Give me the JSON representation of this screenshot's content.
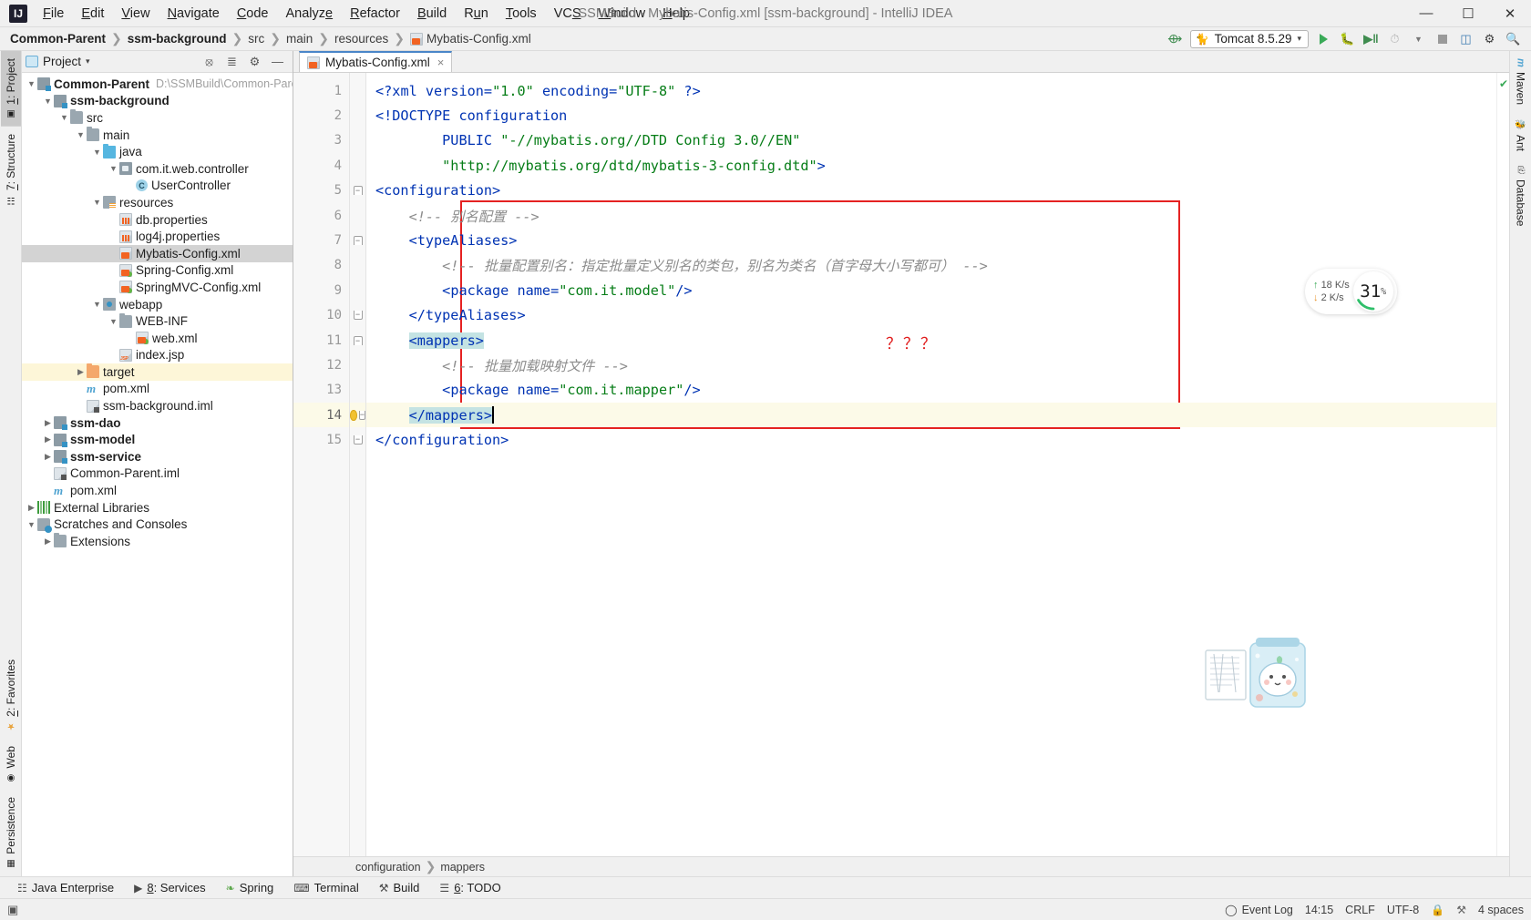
{
  "window": {
    "title": "SSMBuild - Mybatis-Config.xml [ssm-background] - IntelliJ IDEA",
    "logo": "IJ",
    "minimize": "—",
    "maximize": "☐",
    "close": "✕"
  },
  "menu": [
    {
      "label": "File"
    },
    {
      "label": "Edit"
    },
    {
      "label": "View"
    },
    {
      "label": "Navigate"
    },
    {
      "label": "Code"
    },
    {
      "label": "Analyze"
    },
    {
      "label": "Refactor"
    },
    {
      "label": "Build"
    },
    {
      "label": "Run"
    },
    {
      "label": "Tools"
    },
    {
      "label": "VCS"
    },
    {
      "label": "Window"
    },
    {
      "label": "Help"
    }
  ],
  "breadcrumb": [
    {
      "label": "Common-Parent",
      "bold": true
    },
    {
      "label": "ssm-background",
      "bold": true
    },
    {
      "label": "src",
      "bold": false
    },
    {
      "label": "main",
      "bold": false
    },
    {
      "label": "resources",
      "bold": false
    },
    {
      "label": "Mybatis-Config.xml",
      "bold": false,
      "icon": "xml-icon"
    }
  ],
  "toolbar": {
    "build_icon": "hammer-icon",
    "run_config": "Tomcat 8.5.29",
    "dropdown_arrow": "▾",
    "run_icon": "run-icon",
    "debug_icon": "debug-icon",
    "run_coverage_icon": "run-with-coverage-icon",
    "profile_icon": "profile-icon",
    "stop_icon": "stop-icon",
    "layout_icon": "restore-layout-icon",
    "search_icon": "search-everywhere-icon",
    "settings_icon": "settings-icon"
  },
  "left_rail": {
    "top": [
      {
        "label": "1: Project",
        "underline": "1",
        "selected": true,
        "icon": "project-icon"
      },
      {
        "label": "7: Structure",
        "underline": "7",
        "selected": false,
        "icon": "structure-icon"
      }
    ],
    "bottom": [
      {
        "label": "2: Favorites",
        "underline": "2",
        "icon": "star-icon"
      },
      {
        "label": "Web",
        "icon": "web-icon"
      },
      {
        "label": "Persistence",
        "icon": "persistence-icon"
      }
    ]
  },
  "right_rail": [
    {
      "label": "Maven",
      "icon": "maven-icon"
    },
    {
      "label": "Ant",
      "icon": "ant-icon"
    },
    {
      "label": "Database",
      "icon": "database-icon"
    }
  ],
  "project_panel": {
    "title": "Project",
    "dropdown_arrow": "▾",
    "locate_icon": "locate-icon",
    "collapse_icon": "collapse-all-icon",
    "settings_icon": "gear-icon",
    "hide_icon": "hide-icon",
    "tree": [
      {
        "depth": 0,
        "twisty": "▼",
        "icon": "ic-mod",
        "label": "Common-Parent",
        "bold": true,
        "path": "D:\\SSMBuild\\Common-Parent"
      },
      {
        "depth": 1,
        "twisty": "▼",
        "icon": "ic-mod",
        "label": "ssm-background",
        "bold": true
      },
      {
        "depth": 2,
        "twisty": "▼",
        "icon": "ic-folder",
        "label": "src"
      },
      {
        "depth": 3,
        "twisty": "▼",
        "icon": "ic-folder",
        "label": "main"
      },
      {
        "depth": 4,
        "twisty": "▼",
        "icon": "ic-src",
        "label": "java"
      },
      {
        "depth": 5,
        "twisty": "▼",
        "icon": "ic-pkg",
        "label": "com.it.web.controller"
      },
      {
        "depth": 6,
        "twisty": "",
        "icon": "ic-class",
        "label": "UserController"
      },
      {
        "depth": 4,
        "twisty": "▼",
        "icon": "ic-res",
        "label": "resources"
      },
      {
        "depth": 5,
        "twisty": "",
        "icon": "ic-prop",
        "label": "db.properties"
      },
      {
        "depth": 5,
        "twisty": "",
        "icon": "ic-prop",
        "label": "log4j.properties"
      },
      {
        "depth": 5,
        "twisty": "",
        "icon": "ic-xml",
        "label": "Mybatis-Config.xml",
        "selected": true
      },
      {
        "depth": 5,
        "twisty": "",
        "icon": "ic-xml-g",
        "label": "Spring-Config.xml"
      },
      {
        "depth": 5,
        "twisty": "",
        "icon": "ic-xml-g",
        "label": "SpringMVC-Config.xml"
      },
      {
        "depth": 4,
        "twisty": "▼",
        "icon": "ic-webapp",
        "label": "webapp"
      },
      {
        "depth": 5,
        "twisty": "▼",
        "icon": "ic-folder",
        "label": "WEB-INF"
      },
      {
        "depth": 6,
        "twisty": "",
        "icon": "ic-xml-g",
        "label": "web.xml"
      },
      {
        "depth": 5,
        "twisty": "",
        "icon": "ic-jsp",
        "label": "index.jsp"
      },
      {
        "depth": 3,
        "twisty": "▶",
        "icon": "ic-target",
        "label": "target",
        "highlight": true
      },
      {
        "depth": 3,
        "twisty": "",
        "icon": "ic-m",
        "label": "pom.xml"
      },
      {
        "depth": 3,
        "twisty": "",
        "icon": "ic-iml",
        "label": "ssm-background.iml"
      },
      {
        "depth": 1,
        "twisty": "▶",
        "icon": "ic-mod",
        "label": "ssm-dao",
        "bold": true
      },
      {
        "depth": 1,
        "twisty": "▶",
        "icon": "ic-mod",
        "label": "ssm-model",
        "bold": true
      },
      {
        "depth": 1,
        "twisty": "▶",
        "icon": "ic-mod",
        "label": "ssm-service",
        "bold": true
      },
      {
        "depth": 1,
        "twisty": "",
        "icon": "ic-iml",
        "label": "Common-Parent.iml"
      },
      {
        "depth": 1,
        "twisty": "",
        "icon": "ic-m",
        "label": "pom.xml"
      },
      {
        "depth": 0,
        "twisty": "▶",
        "icon": "ic-lib",
        "label": "External Libraries"
      },
      {
        "depth": 0,
        "twisty": "▼",
        "icon": "ic-scratch",
        "label": "Scratches and Consoles"
      },
      {
        "depth": 1,
        "twisty": "▶",
        "icon": "ic-folder",
        "label": "Extensions"
      }
    ]
  },
  "editor": {
    "tab": {
      "label": "Mybatis-Config.xml",
      "close": "×",
      "icon": "xml-icon"
    },
    "annotation": "？？？",
    "lines": [
      {
        "n": 1,
        "fold": "",
        "tokens": [
          {
            "t": "&lt;?",
            "c": "tk-punc"
          },
          {
            "t": "xml",
            "c": "tk-tag"
          },
          {
            "t": " ",
            "c": "tk-txt"
          },
          {
            "t": "version",
            "c": "tk-attr"
          },
          {
            "t": "=",
            "c": "tk-punc"
          },
          {
            "t": "\"1.0\"",
            "c": "tk-val"
          },
          {
            "t": " ",
            "c": "tk-txt"
          },
          {
            "t": "encoding",
            "c": "tk-attr"
          },
          {
            "t": "=",
            "c": "tk-punc"
          },
          {
            "t": "\"UTF-8\"",
            "c": "tk-val"
          },
          {
            "t": " ",
            "c": "tk-txt"
          },
          {
            "t": "?&gt;",
            "c": "tk-punc"
          }
        ]
      },
      {
        "n": 2,
        "fold": "",
        "tokens": [
          {
            "t": "&lt;!DOCTYPE",
            "c": "tk-tag"
          },
          {
            "t": " ",
            "c": "tk-txt"
          },
          {
            "t": "configuration",
            "c": "tk-tag"
          }
        ]
      },
      {
        "n": 3,
        "fold": "",
        "tokens": [
          {
            "t": "        ",
            "c": "tk-txt"
          },
          {
            "t": "PUBLIC",
            "c": "tk-tag"
          },
          {
            "t": " ",
            "c": "tk-txt"
          },
          {
            "t": "\"-//mybatis.org//DTD Config 3.0//EN\"",
            "c": "tk-val"
          }
        ]
      },
      {
        "n": 4,
        "fold": "",
        "tokens": [
          {
            "t": "        ",
            "c": "tk-txt"
          },
          {
            "t": "\"http://mybatis.org/dtd/mybatis-3-config.dtd\"",
            "c": "tk-val"
          },
          {
            "t": "&gt;",
            "c": "tk-punc"
          }
        ]
      },
      {
        "n": 5,
        "fold": "top",
        "tokens": [
          {
            "t": "&lt;configuration&gt;",
            "c": "tk-tag"
          }
        ]
      },
      {
        "n": 6,
        "fold": "",
        "tokens": [
          {
            "t": "    ",
            "c": "tk-txt"
          },
          {
            "t": "&lt;!-- 别名配置 --&gt;",
            "c": "tk-cmt"
          }
        ]
      },
      {
        "n": 7,
        "fold": "top",
        "tokens": [
          {
            "t": "    ",
            "c": "tk-txt"
          },
          {
            "t": "&lt;typeAliases&gt;",
            "c": "tk-tag"
          }
        ]
      },
      {
        "n": 8,
        "fold": "",
        "tokens": [
          {
            "t": "        ",
            "c": "tk-txt"
          },
          {
            "t": "&lt;!-- 批量配置别名：指定批量定义别名的类包，别名为类名（首字母大小写都可） --&gt;",
            "c": "tk-cmt"
          }
        ]
      },
      {
        "n": 9,
        "fold": "",
        "tokens": [
          {
            "t": "        ",
            "c": "tk-txt"
          },
          {
            "t": "&lt;",
            "c": "tk-punc"
          },
          {
            "t": "package",
            "c": "tk-tag"
          },
          {
            "t": " ",
            "c": "tk-txt"
          },
          {
            "t": "name",
            "c": "tk-attr"
          },
          {
            "t": "=",
            "c": "tk-punc"
          },
          {
            "t": "\"com.it.model\"",
            "c": "tk-val"
          },
          {
            "t": "/&gt;",
            "c": "tk-punc"
          }
        ]
      },
      {
        "n": 10,
        "fold": "bot",
        "tokens": [
          {
            "t": "    ",
            "c": "tk-txt"
          },
          {
            "t": "&lt;/typeAliases&gt;",
            "c": "tk-tag"
          }
        ]
      },
      {
        "n": 11,
        "fold": "top",
        "tokens": [
          {
            "t": "    ",
            "c": "tk-txt"
          },
          {
            "t": "&lt;mappers&gt;",
            "c": "tk-tag tk-hl"
          }
        ]
      },
      {
        "n": 12,
        "fold": "",
        "tokens": [
          {
            "t": "        ",
            "c": "tk-txt"
          },
          {
            "t": "&lt;!-- 批量加载映射文件 --&gt;",
            "c": "tk-cmt"
          }
        ]
      },
      {
        "n": 13,
        "fold": "",
        "tokens": [
          {
            "t": "        ",
            "c": "tk-txt"
          },
          {
            "t": "&lt;",
            "c": "tk-punc"
          },
          {
            "t": "package",
            "c": "tk-tag"
          },
          {
            "t": " ",
            "c": "tk-txt"
          },
          {
            "t": "name",
            "c": "tk-attr"
          },
          {
            "t": "=",
            "c": "tk-punc"
          },
          {
            "t": "\"com.it.mapper\"",
            "c": "tk-val"
          },
          {
            "t": "/&gt;",
            "c": "tk-punc"
          }
        ]
      },
      {
        "n": 14,
        "fold": "bot",
        "tokens": [
          {
            "t": "    ",
            "c": "tk-txt"
          },
          {
            "t": "&lt;/mappers&gt;",
            "c": "tk-tag tk-hl"
          }
        ],
        "current": true,
        "bulb": true
      },
      {
        "n": 15,
        "fold": "bot",
        "tokens": [
          {
            "t": "&lt;/configuration&gt;",
            "c": "tk-tag"
          }
        ]
      }
    ],
    "breadcrumb_bottom": [
      {
        "label": "configuration"
      },
      {
        "label": "mappers"
      }
    ]
  },
  "net_widget": {
    "up_arrow": "↑",
    "up_value": "18  K/s",
    "down_arrow": "↓",
    "down_value": "2  K/s",
    "percent": "31",
    "percent_sign": "%"
  },
  "bottom_tools": [
    {
      "label": "Java Enterprise",
      "icon": "java-enterprise-icon",
      "underline": ""
    },
    {
      "label": "8: Services",
      "icon": "services-icon",
      "underline": "8"
    },
    {
      "label": "Spring",
      "icon": "spring-icon",
      "underline": ""
    },
    {
      "label": "Terminal",
      "icon": "terminal-icon",
      "underline": ""
    },
    {
      "label": "Build",
      "icon": "build-icon",
      "underline": ""
    },
    {
      "label": "6: TODO",
      "icon": "todo-icon",
      "underline": "6"
    }
  ],
  "status_bar": {
    "event_log": "Event Log",
    "event_log_icon": "event-log-icon",
    "position": "14:15",
    "line_sep": "CRLF",
    "encoding": "UTF-8",
    "lock_icon": "lock-icon",
    "git_icon": "git-branch-icon",
    "indent": "4 spaces"
  },
  "colors": {
    "accent": "#4a86c8",
    "red_box": "#e52222",
    "run_green": "#3aaa58",
    "highlight_yellow": "#fcfae8",
    "selection_cyan": "#c4e3e3"
  }
}
